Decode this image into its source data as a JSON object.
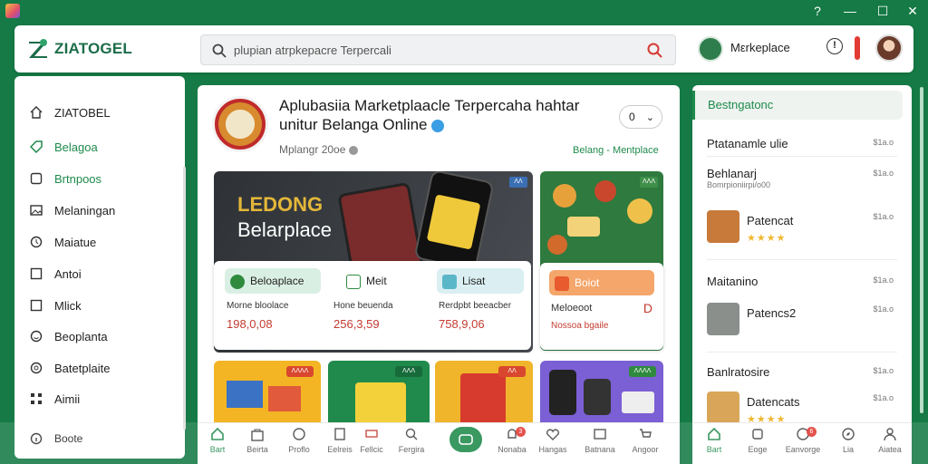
{
  "window": {
    "controls": [
      "?",
      "—",
      "☐",
      "✕"
    ]
  },
  "header": {
    "logo": "ZIATOGEL",
    "search_text": "plupian atrpkepacre Terpercali",
    "marketplace_label": "Mεrkeplace",
    "info_label": "!"
  },
  "sidebar": {
    "items": [
      {
        "label": "ZIATOBEL",
        "icon": "home-icon"
      },
      {
        "label": "Belagoa",
        "icon": "tag-icon"
      },
      {
        "label": "Brtnpoos",
        "icon": "box-icon"
      },
      {
        "label": "Melaningan",
        "icon": "image-icon"
      },
      {
        "label": "Maiatue",
        "icon": "clock-icon"
      },
      {
        "label": "Antoi",
        "icon": "square-icon"
      },
      {
        "label": "Mlick",
        "icon": "square-icon"
      },
      {
        "label": "Beoplanta",
        "icon": "smile-icon"
      },
      {
        "label": "Batetplaite",
        "icon": "gear-icon"
      },
      {
        "label": "Aimii",
        "icon": "grid-icon"
      },
      {
        "label": "Boote",
        "icon": "info-icon"
      }
    ]
  },
  "shop": {
    "title": "Aplubasiia Marketplaacle Terpercaha hahtar unitur Belanga Online",
    "subtitle": "Mplangr 20oe",
    "select_value": "0",
    "breadcrumb": "Belang - Mentplace"
  },
  "banner": {
    "line1": "LEDONG",
    "line2": "Belarplace",
    "tag": "ΛΛ"
  },
  "products": {
    "chips": [
      "Beloaplace",
      "Meit",
      "Lisat",
      "Boiot"
    ],
    "items": [
      {
        "name": "Morne bloolace",
        "price": "198,0,08"
      },
      {
        "name": "Hone beuenda",
        "price": "256,3,59"
      },
      {
        "name": "Rerdpbt beeacber",
        "price": "758,9,06"
      },
      {
        "name": "Meloeoot",
        "price": "",
        "note": "Nossoa bgaile",
        "mark": "D"
      }
    ]
  },
  "tiles": [
    "ΛΛΛΛ",
    "ΛΛΛ",
    "ΛΛ",
    "ΛΛΛΛ"
  ],
  "bottom_nav": [
    {
      "label": "Bart",
      "icon": "home-icon",
      "active": true
    },
    {
      "label": "Beirta",
      "icon": "bag-icon"
    },
    {
      "label": "Proflo",
      "icon": "clock-icon"
    },
    {
      "label": "Eelreis",
      "icon": "doc-icon"
    },
    {
      "label": "Fellcic",
      "icon": "tag-icon"
    },
    {
      "label": "Fergira",
      "icon": "search-icon"
    },
    {
      "label": "",
      "icon": "fab-icon"
    },
    {
      "label": "Nonaba",
      "icon": "bell-icon",
      "badge": "3"
    },
    {
      "label": "Hangas",
      "icon": "heart-icon"
    },
    {
      "label": "Batnana",
      "icon": "image-icon"
    },
    {
      "label": "Angoor",
      "icon": "cart-icon"
    }
  ],
  "right_panel": {
    "header": "Bestngatonc",
    "rows": [
      {
        "title": "Ptatanamle ulie",
        "price": "$1a.o"
      },
      {
        "title": "Behlanarj",
        "sub": "Bomrpioniirpi/o00",
        "price": "$1a.o"
      },
      {
        "title": "Patencat",
        "price": "$1a.o",
        "stars": "★★★★"
      },
      {
        "title": "Maitanino",
        "price": "$1a.o"
      },
      {
        "title": "Patencs2",
        "price": "$1a.o"
      },
      {
        "title": "Banlratosire",
        "price": "$1a.o"
      },
      {
        "title": "Datencats",
        "price": "$1a.o",
        "stars": "★★★★"
      }
    ],
    "nav": [
      {
        "label": "Bart",
        "icon": "home-icon"
      },
      {
        "label": "Eoge",
        "icon": "doc-icon"
      },
      {
        "label": "Eanvorge",
        "icon": "chat-icon",
        "badge": "6"
      },
      {
        "label": "Lia",
        "icon": "compass-icon"
      },
      {
        "label": "Aiatea",
        "icon": "user-icon"
      }
    ]
  }
}
